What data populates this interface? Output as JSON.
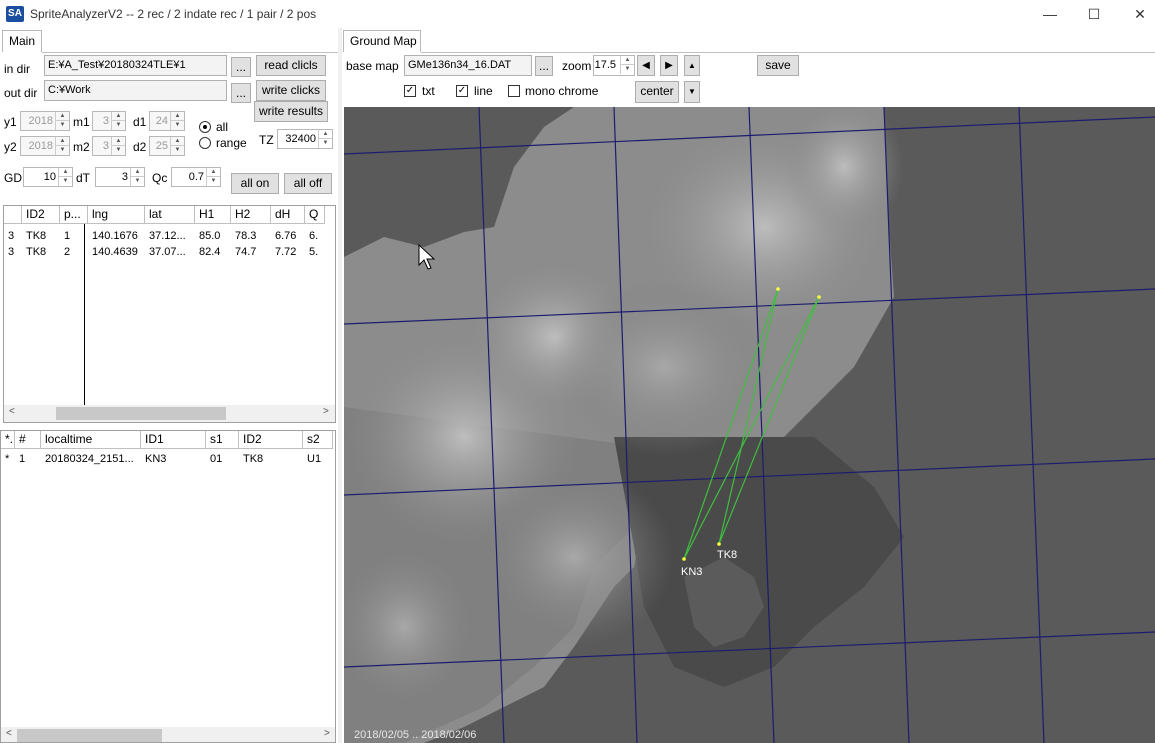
{
  "window": {
    "icon_text": "SA",
    "title": "SpriteAnalyzerV2 --  2 rec  / 2 indate rec / 1 pair / 2 pos",
    "minimize_glyph": "—",
    "maximize_glyph": "☐",
    "close_glyph": "✕"
  },
  "left": {
    "tab_main": "Main",
    "in_dir_label": "in dir",
    "in_dir_value": "E:¥A_Test¥20180324TLE¥1",
    "out_dir_label": "out dir",
    "out_dir_value": "C:¥Work",
    "browse_label": "...",
    "read_btn": "read clicls",
    "write_clicks_btn": "write clicks",
    "write_results_btn": "write results",
    "y1_label": "y1",
    "y1_value": "2018",
    "m1_label": "m1",
    "m1_value": "3",
    "d1_label": "d1",
    "d1_value": "24",
    "y2_label": "y2",
    "y2_value": "2018",
    "m2_label": "m2",
    "m2_value": "3",
    "d2_label": "d2",
    "d2_value": "25",
    "radio_all": "all",
    "radio_range": "range",
    "tz_label": "TZ",
    "tz_value": "32400",
    "gd_label": "GD",
    "gd_value": "10",
    "dt_label": "dT",
    "dt_value": "3",
    "qc_label": "Qc",
    "qc_value": "0.7",
    "all_on_btn": "all on",
    "all_off_btn": "all off",
    "grid1": {
      "headers": [
        "",
        "ID2",
        "p...",
        "lng",
        "lat",
        "H1",
        "H2",
        "dH",
        "Q"
      ],
      "rows": [
        [
          "3",
          "TK8",
          "1",
          "140.1676",
          "37.12...",
          "85.0",
          "78.3",
          "6.76",
          "6."
        ],
        [
          "3",
          "TK8",
          "2",
          "140.4639",
          "37.07...",
          "82.4",
          "74.7",
          "7.72",
          "5."
        ]
      ]
    },
    "grid2": {
      "headers": [
        "*.",
        "#",
        "localtime",
        "ID1",
        "s1",
        "ID2",
        "s2"
      ],
      "rows": [
        [
          "*",
          "1",
          "20180324_2151...",
          "KN3",
          "01",
          "TK8",
          "U1"
        ]
      ]
    }
  },
  "right": {
    "tab_ground_map": "Ground Map",
    "base_map_label": "base map",
    "base_map_value": "GMe136n34_16.DAT",
    "browse_label": "...",
    "zoom_label": "zoom",
    "zoom_value": "17.5",
    "save_btn": "save",
    "txt_label": "txt",
    "txt_checked": true,
    "line_label": "line",
    "line_checked": true,
    "mono_label": "mono chrome",
    "mono_checked": false,
    "center_btn": "center",
    "stations": [
      {
        "name": "KN3"
      },
      {
        "name": "TK8"
      }
    ],
    "date_range": "2018/02/05 .. 2018/02/06",
    "colors": {
      "grid_lines": "#1c1c6e",
      "track_lines": "#3fbf3f",
      "points": "#ffff40",
      "map_dark": "#5a5a5a"
    }
  }
}
